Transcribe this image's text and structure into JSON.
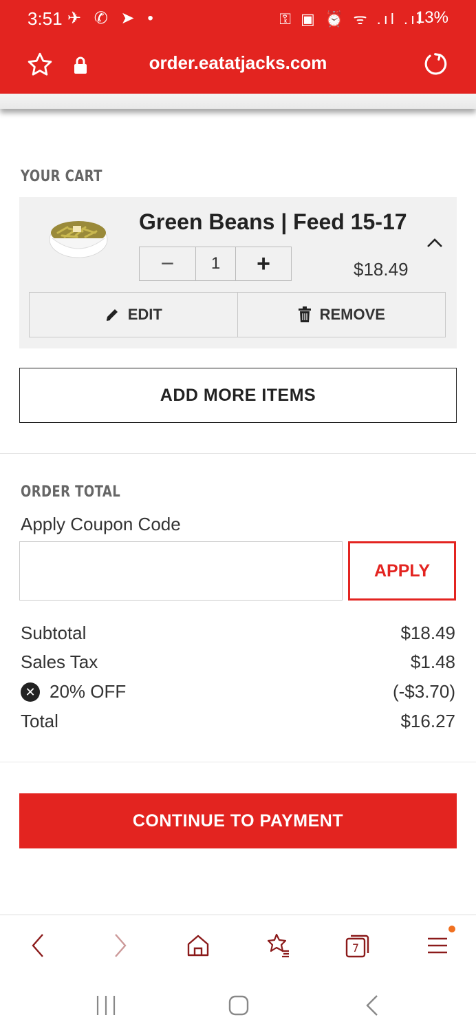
{
  "status_bar": {
    "time": "3:51",
    "notification_icons": "✈ ✆ ➤ •",
    "system_icons": "⚿ ▣ ⏰ ᯤ .ıl .ıl",
    "battery": "13%"
  },
  "browser": {
    "url": "order.eatatjacks.com",
    "accent_color": "#e32420",
    "tab_count": "7"
  },
  "cart": {
    "section_label": "YOUR CART",
    "item": {
      "name": "Green Beans | Feed 15-17",
      "quantity": "1",
      "minus_label": "−",
      "plus_label": "+",
      "price": "$18.49",
      "edit_label": "EDIT",
      "remove_label": "REMOVE"
    },
    "add_more_label": "ADD MORE ITEMS"
  },
  "order_total": {
    "section_label": "ORDER TOTAL",
    "coupon_label": "Apply Coupon Code",
    "coupon_value": "",
    "apply_label": "APPLY",
    "rows": [
      {
        "label": "Subtotal",
        "value": "$18.49"
      },
      {
        "label": "Sales Tax",
        "value": "$1.48"
      },
      {
        "label": "20% OFF",
        "value": "(-$3.70)"
      },
      {
        "label": "Total",
        "value": "$16.27"
      }
    ],
    "remove_discount_glyph": "✕"
  },
  "continue_label": "CONTINUE TO PAYMENT"
}
